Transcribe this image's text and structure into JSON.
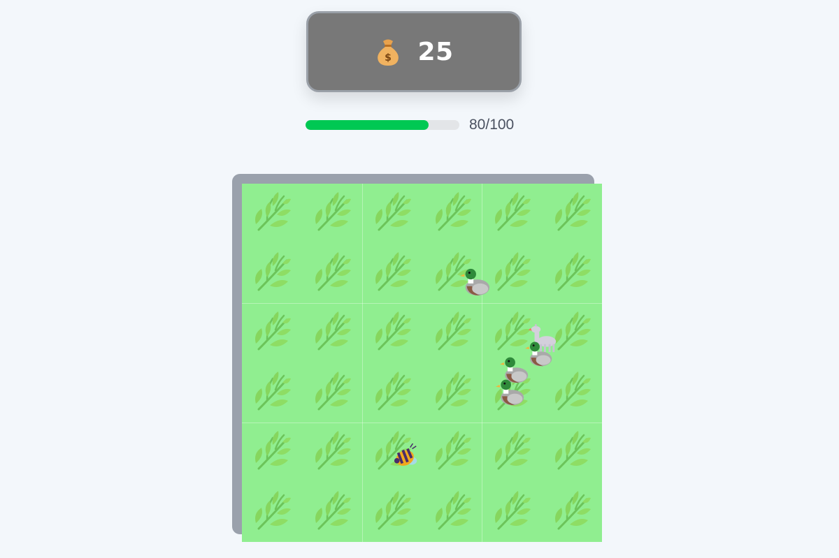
{
  "currency": {
    "icon": "money-bag-icon",
    "amount": "25"
  },
  "progress": {
    "current": 80,
    "max": 100,
    "fraction": 0.8,
    "label": "80/100",
    "color": "#00c853"
  },
  "farm": {
    "rows": 3,
    "cols": 3,
    "plants_per_plot": 4,
    "tile_color": "#90ee90",
    "plant_icon": "herb-sprout-icon",
    "animals": [
      {
        "type": "duck",
        "icon": "duck-icon",
        "plot_row": 0,
        "plot_col": 1
      },
      {
        "type": "llama",
        "icon": "llama-icon",
        "plot_row": 1,
        "plot_col": 2
      },
      {
        "type": "duck",
        "icon": "duck-icon",
        "plot_row": 1,
        "plot_col": 2
      },
      {
        "type": "duck",
        "icon": "duck-icon",
        "plot_row": 1,
        "plot_col": 2
      },
      {
        "type": "duck",
        "icon": "duck-icon",
        "plot_row": 1,
        "plot_col": 2
      },
      {
        "type": "bee",
        "icon": "bee-icon",
        "plot_row": 2,
        "plot_col": 1
      }
    ]
  }
}
